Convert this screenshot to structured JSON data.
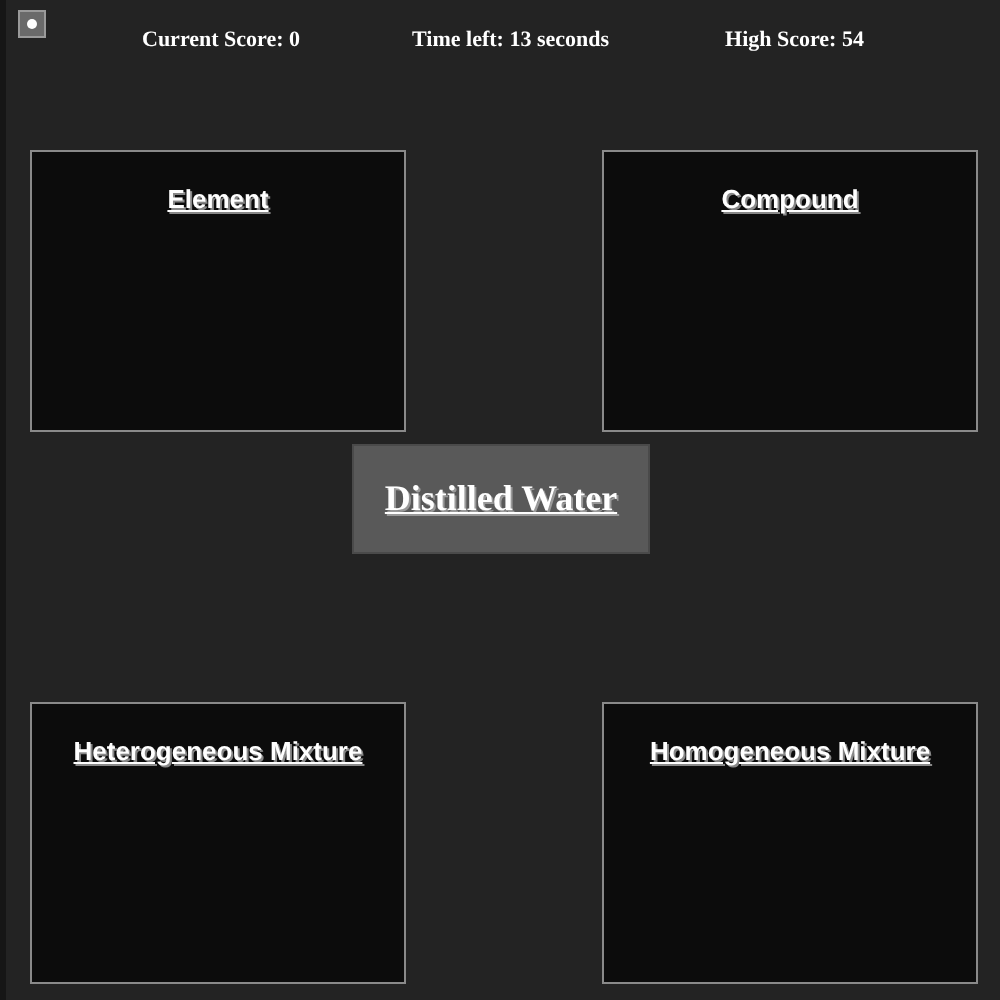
{
  "stats": [
    "Current Score: 0",
    "Time left: 13 seconds",
    "High Score: 54"
  ],
  "categories": [
    {
      "label": "Element"
    },
    {
      "label": "Compound"
    },
    {
      "label": "Heterogeneous Mixture"
    },
    {
      "label": "Homogeneous Mixture"
    }
  ],
  "current_item": "Distilled Water"
}
